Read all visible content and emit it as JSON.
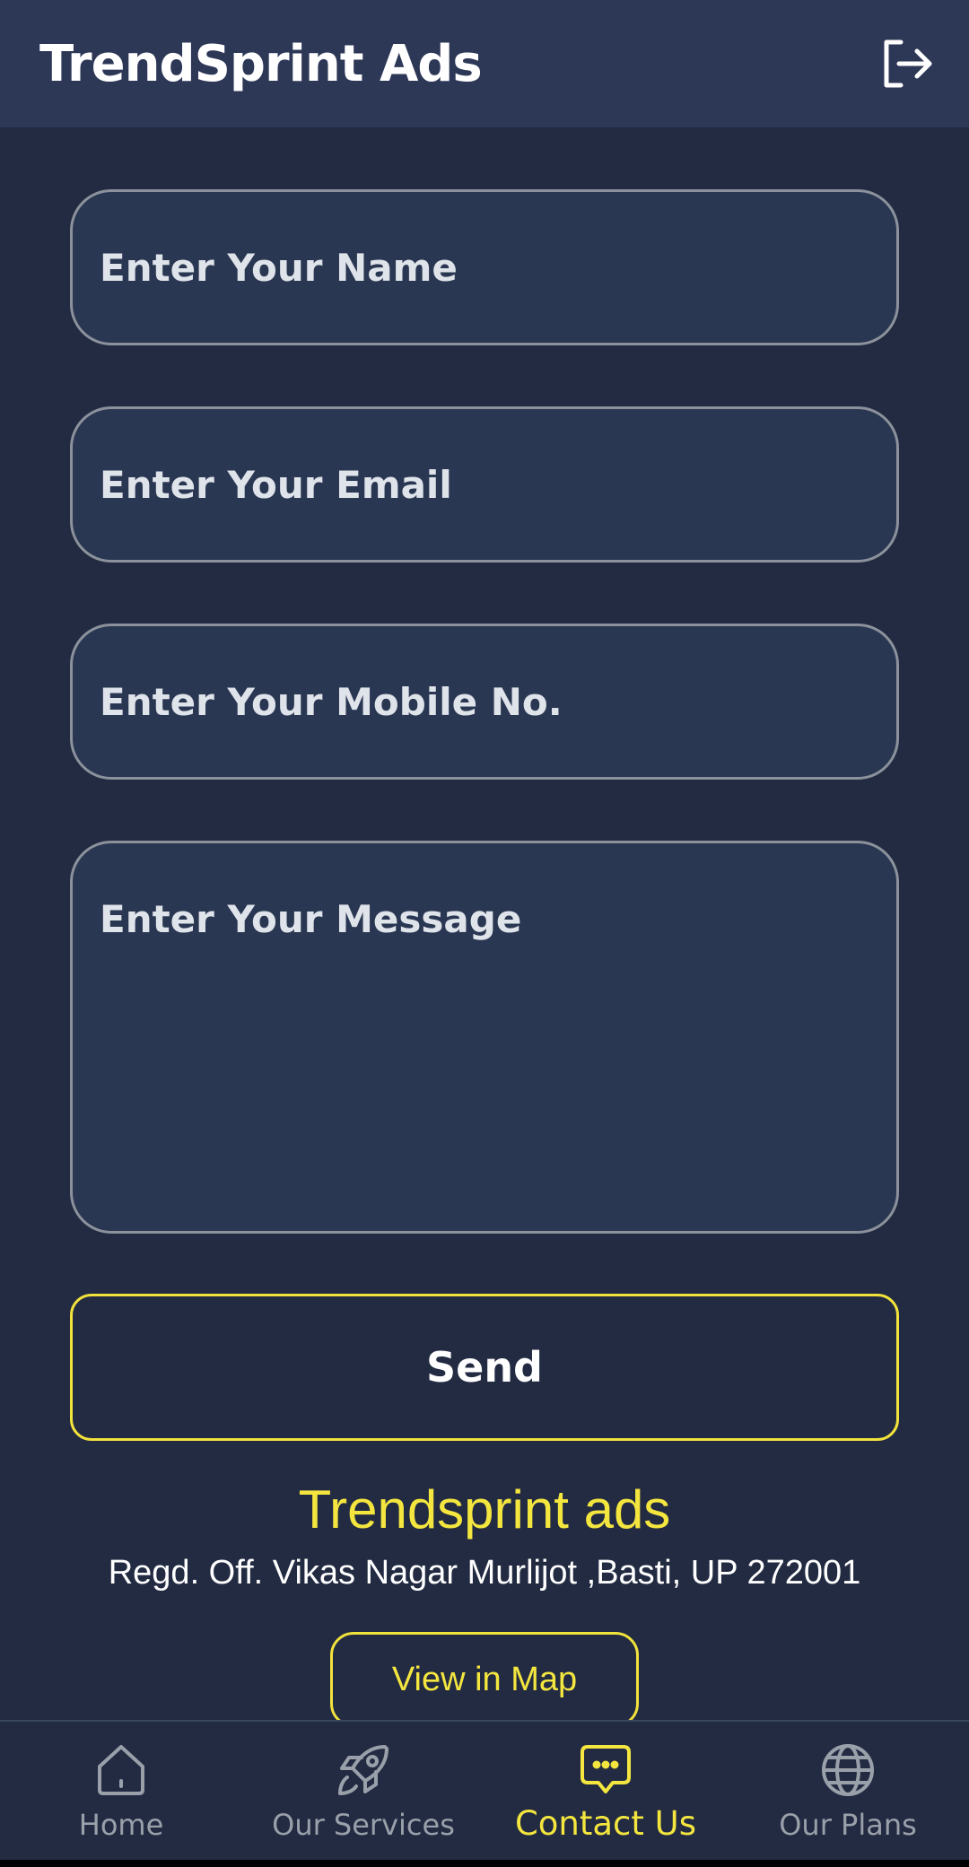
{
  "app_bar": {
    "title": "TrendSprint Ads",
    "action_icon": "logout-icon"
  },
  "form": {
    "name_placeholder": "Enter Your Name",
    "email_placeholder": "Enter Your Email",
    "mobile_placeholder": "Enter Your Mobile No.",
    "message_placeholder": "Enter Your Message",
    "send_label": "Send"
  },
  "company": {
    "name": "Trendsprint ads",
    "address": "Regd. Off. Vikas Nagar Murlijot ,Basti, UP 272001",
    "map_button_label": "View in Map"
  },
  "bottom_nav": {
    "items": [
      {
        "label": "Home",
        "icon": "home-icon",
        "active": false
      },
      {
        "label": "Our Services",
        "icon": "rocket-icon",
        "active": false
      },
      {
        "label": "Contact Us",
        "icon": "chat-bubble-icon",
        "active": true
      },
      {
        "label": "Our Plans",
        "icon": "globe-icon",
        "active": false
      }
    ]
  },
  "colors": {
    "background": "#222b42",
    "app_bar": "#2d3756",
    "field_fill": "#2a3752",
    "accent_yellow": "#f4e63f",
    "inactive_nav": "#9aa0aa"
  }
}
